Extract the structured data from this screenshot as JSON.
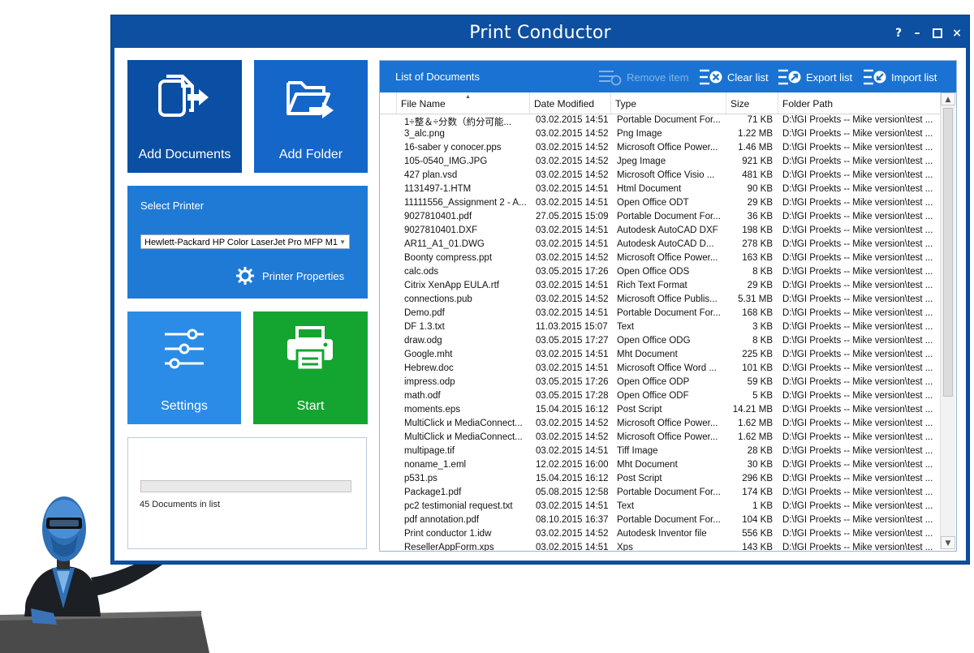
{
  "window": {
    "title": "Print Conductor",
    "help_label": "?",
    "minimize_label": "–",
    "close_label": "×"
  },
  "tiles": {
    "add_documents": "Add Documents",
    "add_folder": "Add Folder",
    "select_printer": "Select Printer",
    "printer_name": "Hewlett-Packard HP Color LaserJet Pro MFP M1",
    "printer_properties": "Printer Properties",
    "settings": "Settings",
    "start": "Start"
  },
  "status": {
    "progress": 0,
    "documents_count": "45 Documents in list"
  },
  "list": {
    "title": "List of Documents",
    "remove_item": "Remove item",
    "clear_list": "Clear list",
    "export_list": "Export list",
    "import_list": "Import list",
    "columns": [
      "File Name",
      "Date Modified",
      "Type",
      "Size",
      "Folder Path"
    ],
    "sort_column": "File Name",
    "rows": [
      [
        "1÷整＆÷分数（約分可能...",
        "03.02.2015 14:51",
        "Portable Document For...",
        "71 KB",
        "D:\\fGI Proekts -- Mike version\\test ..."
      ],
      [
        "3_alc.png",
        "03.02.2015 14:52",
        "Png Image",
        "1.22 MB",
        "D:\\fGI Proekts -- Mike version\\test ..."
      ],
      [
        "16-saber y conocer.pps",
        "03.02.2015 14:52",
        "Microsoft Office Power...",
        "1.46 MB",
        "D:\\fGI Proekts -- Mike version\\test ..."
      ],
      [
        "105-0540_IMG.JPG",
        "03.02.2015 14:52",
        "Jpeg Image",
        "921 KB",
        "D:\\fGI Proekts -- Mike version\\test ..."
      ],
      [
        "427 plan.vsd",
        "03.02.2015 14:52",
        "Microsoft Office Visio ...",
        "481 KB",
        "D:\\fGI Proekts -- Mike version\\test ..."
      ],
      [
        "1131497-1.HTM",
        "03.02.2015 14:51",
        "Html Document",
        "90 KB",
        "D:\\fGI Proekts -- Mike version\\test ..."
      ],
      [
        "11111556_Assignment 2 - A...",
        "03.02.2015 14:51",
        "Open Office ODT",
        "29 KB",
        "D:\\fGI Proekts -- Mike version\\test ..."
      ],
      [
        "9027810401.pdf",
        "27.05.2015 15:09",
        "Portable Document For...",
        "36 KB",
        "D:\\fGI Proekts -- Mike version\\test ..."
      ],
      [
        "9027810401.DXF",
        "03.02.2015 14:51",
        "Autodesk AutoCAD DXF",
        "198 KB",
        "D:\\fGI Proekts -- Mike version\\test ..."
      ],
      [
        "AR11_A1_01.DWG",
        "03.02.2015 14:51",
        "Autodesk AutoCAD D...",
        "278 KB",
        "D:\\fGI Proekts -- Mike version\\test ..."
      ],
      [
        "Boonty compress.ppt",
        "03.02.2015 14:52",
        "Microsoft Office Power...",
        "163 KB",
        "D:\\fGI Proekts -- Mike version\\test ..."
      ],
      [
        "calc.ods",
        "03.05.2015 17:26",
        "Open Office ODS",
        "8 KB",
        "D:\\fGI Proekts -- Mike version\\test ..."
      ],
      [
        "Citrix XenApp EULA.rtf",
        "03.02.2015 14:51",
        "Rich Text Format",
        "29 KB",
        "D:\\fGI Proekts -- Mike version\\test ..."
      ],
      [
        "connections.pub",
        "03.02.2015 14:52",
        "Microsoft Office Publis...",
        "5.31 MB",
        "D:\\fGI Proekts -- Mike version\\test ..."
      ],
      [
        "Demo.pdf",
        "03.02.2015 14:51",
        "Portable Document For...",
        "168 KB",
        "D:\\fGI Proekts -- Mike version\\test ..."
      ],
      [
        "DF 1.3.txt",
        "11.03.2015 15:07",
        "Text",
        "3 KB",
        "D:\\fGI Proekts -- Mike version\\test ..."
      ],
      [
        "draw.odg",
        "03.05.2015 17:27",
        "Open Office ODG",
        "8 KB",
        "D:\\fGI Proekts -- Mike version\\test ..."
      ],
      [
        "Google.mht",
        "03.02.2015 14:51",
        "Mht Document",
        "225 KB",
        "D:\\fGI Proekts -- Mike version\\test ..."
      ],
      [
        "Hebrew.doc",
        "03.02.2015 14:51",
        "Microsoft Office Word ...",
        "101 KB",
        "D:\\fGI Proekts -- Mike version\\test ..."
      ],
      [
        "impress.odp",
        "03.05.2015 17:26",
        "Open Office ODP",
        "59 KB",
        "D:\\fGI Proekts -- Mike version\\test ..."
      ],
      [
        "math.odf",
        "03.05.2015 17:28",
        "Open Office ODF",
        "5 KB",
        "D:\\fGI Proekts -- Mike version\\test ..."
      ],
      [
        "moments.eps",
        "15.04.2015 16:12",
        "Post Script",
        "14.21 MB",
        "D:\\fGI Proekts -- Mike version\\test ..."
      ],
      [
        "MultiClick и MediaConnect...",
        "03.02.2015 14:52",
        "Microsoft Office Power...",
        "1.62 MB",
        "D:\\fGI Proekts -- Mike version\\test ..."
      ],
      [
        "MultiClick и MediaConnect...",
        "03.02.2015 14:52",
        "Microsoft Office Power...",
        "1.62 MB",
        "D:\\fGI Proekts -- Mike version\\test ..."
      ],
      [
        "multipage.tif",
        "03.02.2015 14:51",
        "Tiff Image",
        "28 KB",
        "D:\\fGI Proekts -- Mike version\\test ..."
      ],
      [
        "noname_1.eml",
        "12.02.2015 16:00",
        "Mht Document",
        "30 KB",
        "D:\\fGI Proekts -- Mike version\\test ..."
      ],
      [
        "p531.ps",
        "15.04.2015 16:12",
        "Post Script",
        "296 KB",
        "D:\\fGI Proekts -- Mike version\\test ..."
      ],
      [
        "Package1.pdf",
        "05.08.2015 12:58",
        "Portable Document For...",
        "174 KB",
        "D:\\fGI Proekts -- Mike version\\test ..."
      ],
      [
        "pc2 testimonial request.txt",
        "03.02.2015 14:51",
        "Text",
        "1 KB",
        "D:\\fGI Proekts -- Mike version\\test ..."
      ],
      [
        "pdf annotation.pdf",
        "08.10.2015 16:37",
        "Portable Document For...",
        "104 KB",
        "D:\\fGI Proekts -- Mike version\\test ..."
      ],
      [
        "Print conductor 1.idw",
        "03.02.2015 14:52",
        "Autodesk Inventor file",
        "556 KB",
        "D:\\fGI Proekts -- Mike version\\test ..."
      ],
      [
        "ResellerAppForm.xps",
        "03.02.2015 14:51",
        "Xps",
        "143 KB",
        "D:\\fGI Proekts -- Mike version\\test ..."
      ]
    ]
  }
}
